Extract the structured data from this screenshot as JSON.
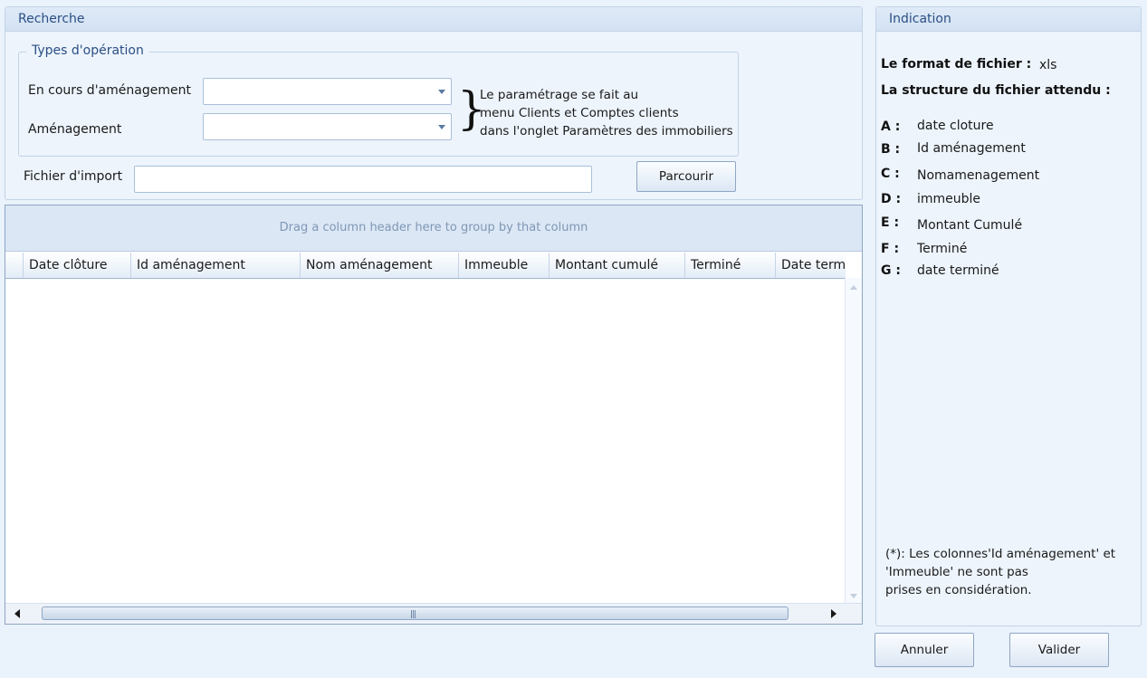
{
  "recherche": {
    "title": "Recherche",
    "types_operation": {
      "legend": "Types d'opération",
      "en_cours_label": "En cours d'aménagement",
      "en_cours_value": "",
      "amenagement_label": "Aménagement",
      "amenagement_value": "",
      "note_line1": "Le paramétrage se fait au",
      "note_line2": "menu Clients et Comptes clients",
      "note_line3": "dans l'onglet Paramètres des immobiliers"
    },
    "fichier_label": "Fichier d'import",
    "fichier_value": "",
    "parcourir_label": "Parcourir"
  },
  "grid": {
    "group_hint": "Drag a column header here to group by that column",
    "columns": [
      "Date clôture",
      "Id aménagement",
      "Nom aménagement",
      "Immeuble",
      "Montant cumulé",
      "Terminé",
      "Date termi"
    ],
    "rows": []
  },
  "indication": {
    "title": "Indication",
    "format_label": "Le format de fichier :",
    "format_value": "xls",
    "structure_label": "La structure du fichier attendu :",
    "structure": [
      {
        "letter": "A :",
        "field": "date cloture"
      },
      {
        "letter": "B :",
        "field": "Id aménagement"
      },
      {
        "letter": "C :",
        "field": "Nomamenagement"
      },
      {
        "letter": "D :",
        "field": "immeuble"
      },
      {
        "letter": "E :",
        "field": "Montant Cumulé"
      },
      {
        "letter": "F :",
        "field": "Terminé"
      },
      {
        "letter": "G :",
        "field": "date terminé"
      }
    ],
    "footnote_line1": "(*): Les colonnes'Id aménagement' et",
    "footnote_line2": "'Immeuble' ne sont pas",
    "footnote_line3": "prises en considération."
  },
  "actions": {
    "annuler_label": "Annuler",
    "valider_label": "Valider"
  }
}
